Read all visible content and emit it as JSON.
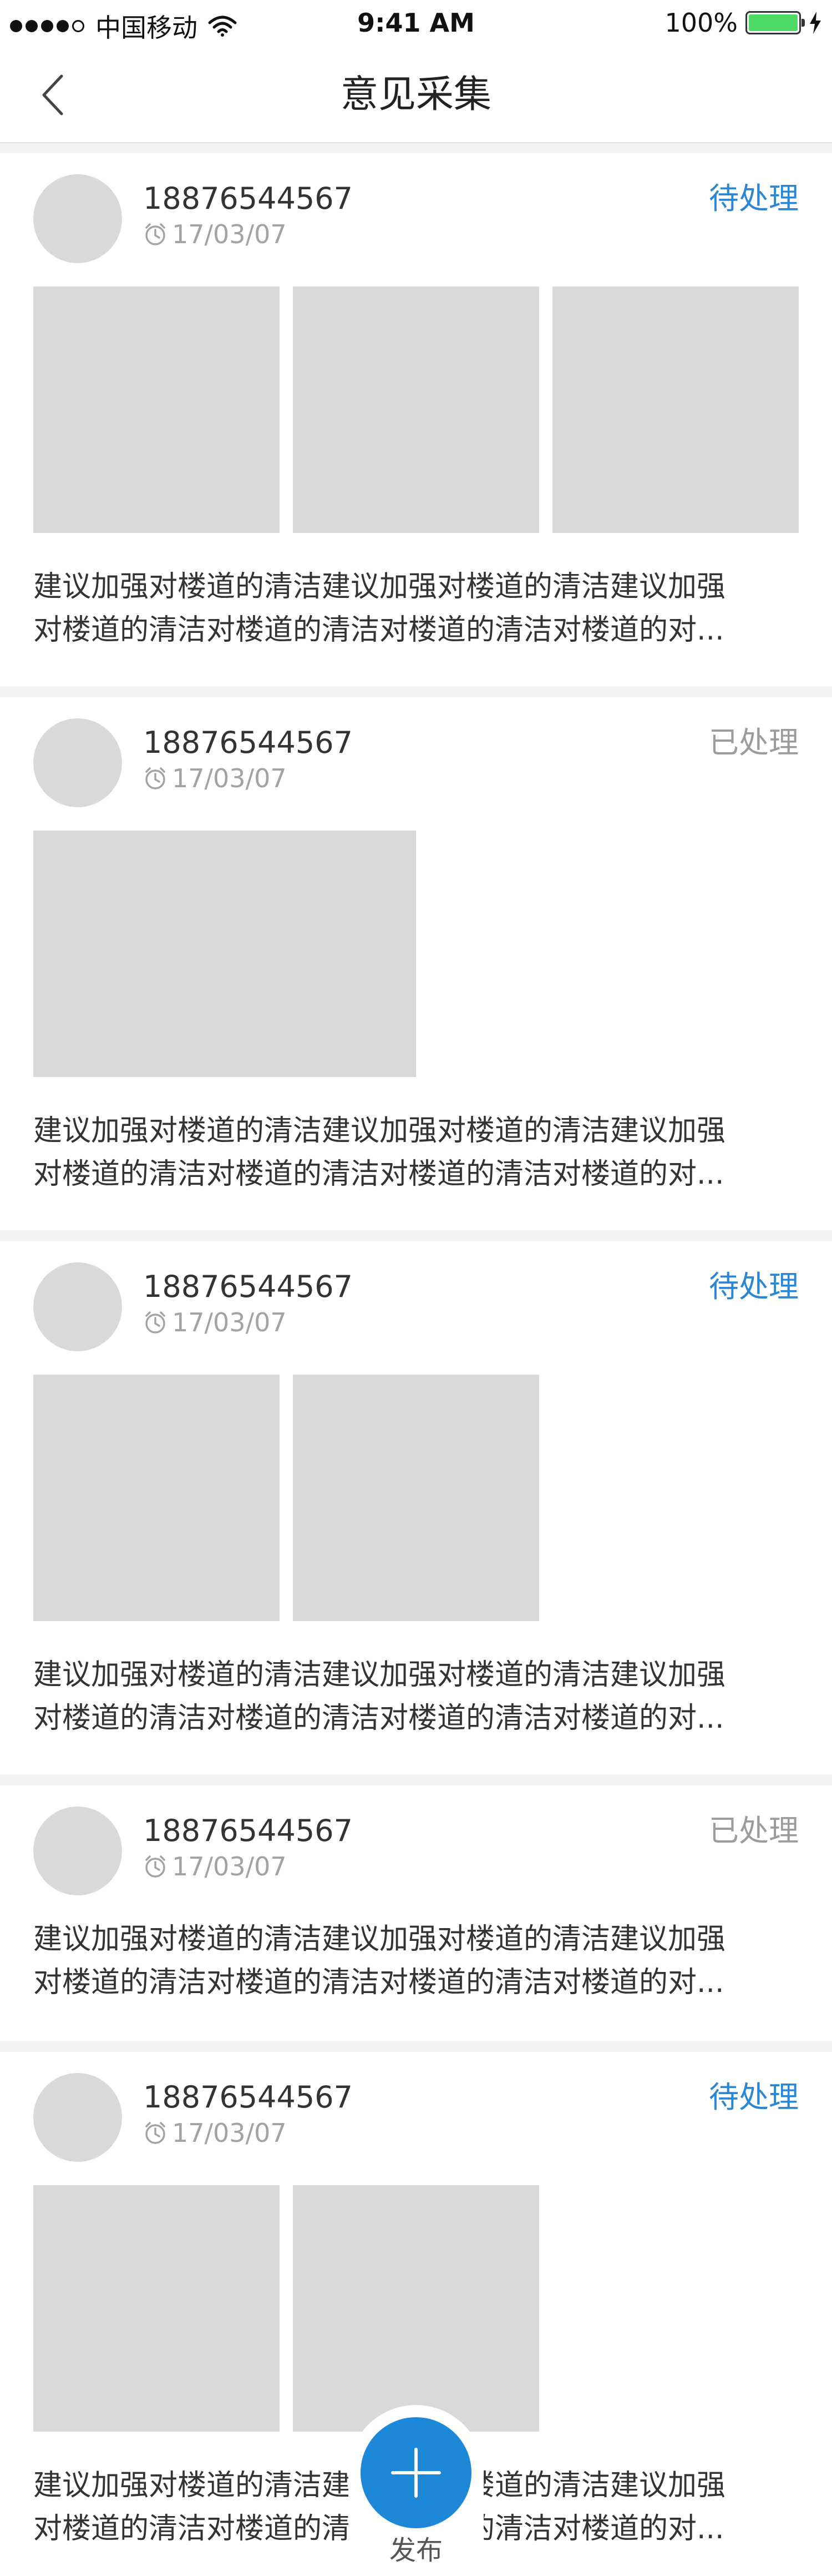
{
  "status_bar": {
    "carrier": "中国移动",
    "time": "9:41 AM",
    "battery": "100%"
  },
  "nav": {
    "title": "意见采集",
    "back_icon": "chevron-left-icon"
  },
  "feedback_items": [
    {
      "phone": "18876544567",
      "date": "17/03/07",
      "status": "待处理",
      "status_color": "#2b86d6",
      "image_count": 3,
      "description": "建议加强对楼道的清洁建议加强对楼道的清洁建议加强\n对楼道的清洁对楼道的清洁对楼道的清洁对楼道的对..."
    },
    {
      "phone": "18876544567",
      "date": "17/03/07",
      "status": "已处理",
      "status_color": "#9c9c9c",
      "image_count": 1,
      "description": "建议加强对楼道的清洁建议加强对楼道的清洁建议加强\n对楼道的清洁对楼道的清洁对楼道的清洁对楼道的对..."
    },
    {
      "phone": "18876544567",
      "date": "17/03/07",
      "status": "待处理",
      "status_color": "#2b86d6",
      "image_count": 2,
      "description": "建议加强对楼道的清洁建议加强对楼道的清洁建议加强\n对楼道的清洁对楼道的清洁对楼道的清洁对楼道的对..."
    },
    {
      "phone": "18876544567",
      "date": "17/03/07",
      "status": "已处理",
      "status_color": "#9c9c9c",
      "image_count": 0,
      "description": "建议加强对楼道的清洁建议加强对楼道的清洁建议加强\n对楼道的清洁对楼道的清洁对楼道的清洁对楼道的对..."
    },
    {
      "phone": "18876544567",
      "date": "17/03/07",
      "status": "待处理",
      "status_color": "#2b86d6",
      "image_count": 2,
      "description": "建议加强对楼道的清洁建议加强对楼道的清洁建议加强\n对楼道的清洁对楼道的清洁对楼道的清洁对楼道的对..."
    }
  ],
  "fab": {
    "label": "发布",
    "icon": "plus-icon",
    "color": "#1e88d8"
  }
}
